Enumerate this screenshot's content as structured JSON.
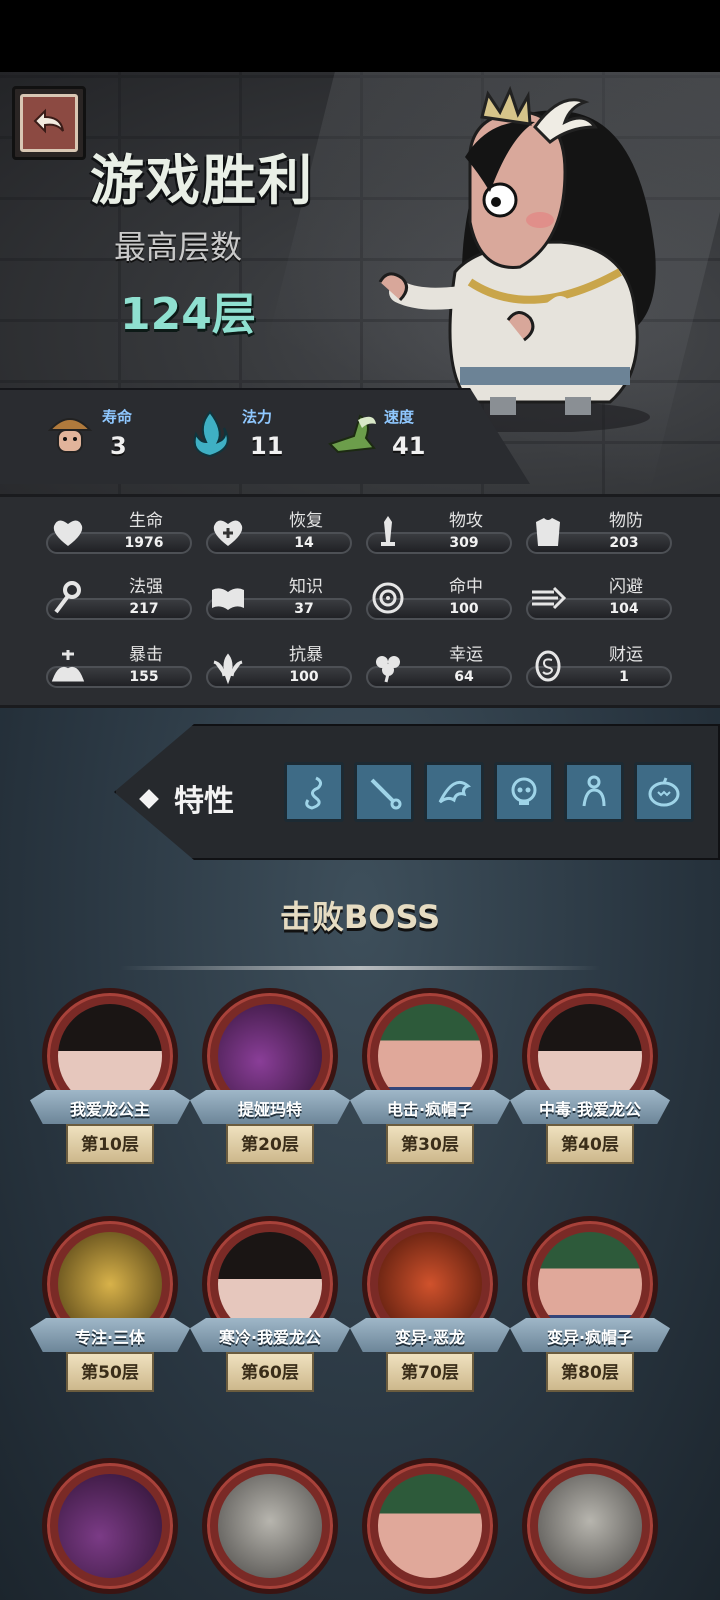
{
  "header": {
    "title": "游戏胜利",
    "subtitle": "最高层数",
    "highest_floor": "124层"
  },
  "attributes": [
    {
      "label": "寿命",
      "value": "3",
      "icon": "mushroom-head-icon"
    },
    {
      "label": "法力",
      "value": "11",
      "icon": "blue-flame-icon"
    },
    {
      "label": "速度",
      "value": "41",
      "icon": "winged-boot-icon"
    }
  ],
  "stats": [
    {
      "label": "生命",
      "value": "1976",
      "icon": "heart-icon"
    },
    {
      "label": "恢复",
      "value": "14",
      "icon": "heart-plus-icon"
    },
    {
      "label": "物攻",
      "value": "309",
      "icon": "sword-icon"
    },
    {
      "label": "物防",
      "value": "203",
      "icon": "armor-icon"
    },
    {
      "label": "法强",
      "value": "217",
      "icon": "staff-icon"
    },
    {
      "label": "知识",
      "value": "37",
      "icon": "book-icon"
    },
    {
      "label": "命中",
      "value": "100",
      "icon": "target-icon"
    },
    {
      "label": "闪避",
      "value": "104",
      "icon": "dash-arrow-icon"
    },
    {
      "label": "暴击",
      "value": "155",
      "icon": "crit-splash-icon"
    },
    {
      "label": "抗暴",
      "value": "100",
      "icon": "shield-wings-icon"
    },
    {
      "label": "幸运",
      "value": "64",
      "icon": "clover-icon"
    },
    {
      "label": "财运",
      "value": "1",
      "icon": "coin-icon"
    }
  ],
  "traits": {
    "label": "特性",
    "icons": [
      "serpent-icon",
      "sword-diagonal-icon",
      "claw-shell-icon",
      "skull-icon",
      "figure-icon",
      "pumpkin-icon"
    ]
  },
  "bosses": {
    "title": "击败BOSS",
    "items": [
      {
        "name": "我爱龙公主",
        "floor": "第10层"
      },
      {
        "name": "提娅玛特",
        "floor": "第20层"
      },
      {
        "name": "电击·疯帽子",
        "floor": "第30层"
      },
      {
        "name": "中毒·我爱龙公",
        "floor": "第40层"
      },
      {
        "name": "专注·三体",
        "floor": "第50层"
      },
      {
        "name": "寒冷·我爱龙公",
        "floor": "第60层"
      },
      {
        "name": "变异·恶龙",
        "floor": "第70层"
      },
      {
        "name": "变异·疯帽子",
        "floor": "第80层"
      }
    ]
  },
  "colors": {
    "floor_teal": "#8fe0d0",
    "attr_label_blue": "#8fc8ff",
    "trait_tile": "#3e6b86",
    "medal_red": "#7a2a26"
  }
}
